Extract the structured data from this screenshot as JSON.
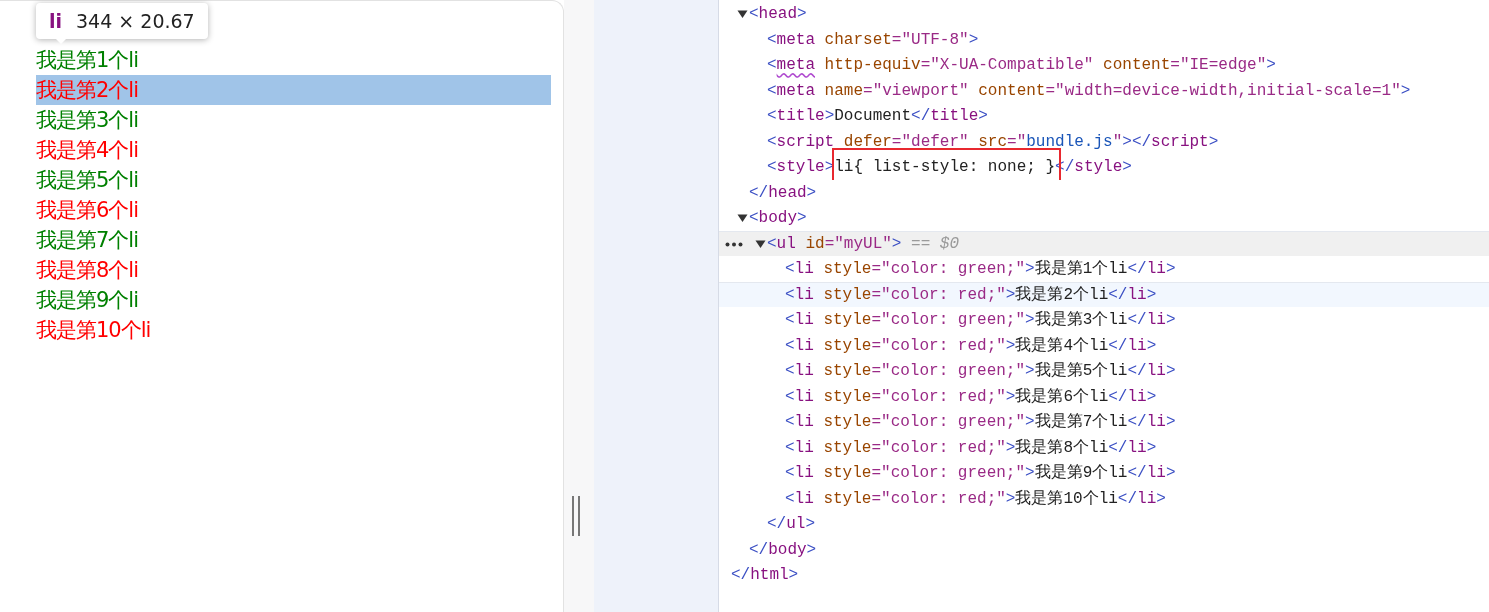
{
  "tooltip": {
    "tag": "li",
    "size": "344 × 20.67"
  },
  "list_items": [
    {
      "text": "我是第1个li",
      "color": "#008000",
      "selected": false
    },
    {
      "text": "我是第2个li",
      "color": "#ff0000",
      "selected": true
    },
    {
      "text": "我是第3个li",
      "color": "#008000",
      "selected": false
    },
    {
      "text": "我是第4个li",
      "color": "#ff0000",
      "selected": false
    },
    {
      "text": "我是第5个li",
      "color": "#008000",
      "selected": false
    },
    {
      "text": "我是第6个li",
      "color": "#ff0000",
      "selected": false
    },
    {
      "text": "我是第7个li",
      "color": "#008000",
      "selected": false
    },
    {
      "text": "我是第8个li",
      "color": "#ff0000",
      "selected": false
    },
    {
      "text": "我是第9个li",
      "color": "#008000",
      "selected": false
    },
    {
      "text": "我是第10个li",
      "color": "#ff0000",
      "selected": false
    }
  ],
  "dom": {
    "close": [
      {
        "kind": "b",
        "text": "</"
      },
      {
        "kind": "tag",
        "text": "html"
      },
      {
        "kind": "b",
        "text": ">"
      }
    ],
    "children": [
      {
        "selected": false,
        "hovered": false,
        "expanded": true,
        "open": [
          {
            "kind": "b",
            "text": "<"
          },
          {
            "kind": "tag",
            "text": "head"
          },
          {
            "kind": "b",
            "text": ">"
          }
        ],
        "close": [
          {
            "kind": "b",
            "text": "</"
          },
          {
            "kind": "tag",
            "text": "head"
          },
          {
            "kind": "b",
            "text": ">"
          }
        ],
        "children": [
          {
            "selected": false,
            "hovered": false,
            "open": [
              {
                "kind": "b",
                "text": "<"
              },
              {
                "kind": "tag",
                "text": "meta"
              },
              {
                "kind": "attr",
                "text": " charset"
              },
              {
                "kind": "val",
                "text": "=\"UTF-8\""
              },
              {
                "kind": "b",
                "text": ">"
              }
            ]
          },
          {
            "selected": false,
            "hovered": false,
            "open": [
              {
                "kind": "b",
                "text": "<"
              },
              {
                "kind": "tag",
                "text": "meta",
                "squiggle": true
              },
              {
                "kind": "attr",
                "text": " http-equiv"
              },
              {
                "kind": "val",
                "text": "=\"X-UA-Compatible\""
              },
              {
                "kind": "attr",
                "text": " content"
              },
              {
                "kind": "val",
                "text": "=\"IE=edge\""
              },
              {
                "kind": "b",
                "text": ">"
              }
            ]
          },
          {
            "selected": false,
            "hovered": false,
            "open": [
              {
                "kind": "b",
                "text": "<"
              },
              {
                "kind": "tag",
                "text": "meta"
              },
              {
                "kind": "attr",
                "text": " name"
              },
              {
                "kind": "val",
                "text": "=\"viewport\""
              },
              {
                "kind": "attr",
                "text": " content"
              },
              {
                "kind": "val",
                "text": "=\"width=device-width,initial-scale=1\""
              },
              {
                "kind": "b",
                "text": ">"
              }
            ]
          },
          {
            "selected": false,
            "hovered": false,
            "open": [
              {
                "kind": "b",
                "text": "<"
              },
              {
                "kind": "tag",
                "text": "title"
              },
              {
                "kind": "b",
                "text": ">"
              },
              {
                "kind": "text",
                "text": "Document"
              },
              {
                "kind": "b",
                "text": "</"
              },
              {
                "kind": "tag",
                "text": "title"
              },
              {
                "kind": "b",
                "text": ">"
              }
            ]
          },
          {
            "selected": false,
            "hovered": false,
            "open": [
              {
                "kind": "b",
                "text": "<"
              },
              {
                "kind": "tag",
                "text": "script"
              },
              {
                "kind": "attr",
                "text": " defer"
              },
              {
                "kind": "val",
                "text": "=\"defer\""
              },
              {
                "kind": "attr",
                "text": " src"
              },
              {
                "kind": "val",
                "text": "=\""
              },
              {
                "kind": "link",
                "text": "bundle.js"
              },
              {
                "kind": "val",
                "text": "\""
              },
              {
                "kind": "b",
                "text": ">"
              },
              {
                "kind": "b",
                "text": "</"
              },
              {
                "kind": "tag",
                "text": "script"
              },
              {
                "kind": "b",
                "text": ">"
              }
            ]
          },
          {
            "selected": false,
            "hovered": false,
            "open": [
              {
                "kind": "b",
                "text": "<"
              },
              {
                "kind": "tag",
                "text": "style"
              },
              {
                "kind": "b",
                "text": ">"
              },
              {
                "kind": "text",
                "text": "li{ list-style: none; }",
                "boxed": true
              },
              {
                "kind": "b",
                "text": "</"
              },
              {
                "kind": "tag",
                "text": "style"
              },
              {
                "kind": "b",
                "text": ">"
              }
            ]
          }
        ]
      },
      {
        "selected": false,
        "hovered": false,
        "expanded": true,
        "open": [
          {
            "kind": "b",
            "text": "<"
          },
          {
            "kind": "tag",
            "text": "body"
          },
          {
            "kind": "b",
            "text": ">"
          }
        ],
        "close": [
          {
            "kind": "b",
            "text": "</"
          },
          {
            "kind": "tag",
            "text": "body"
          },
          {
            "kind": "b",
            "text": ">"
          }
        ],
        "children": [
          {
            "selected": true,
            "hovered": false,
            "expanded": true,
            "open": [
              {
                "kind": "b",
                "text": "<"
              },
              {
                "kind": "tag",
                "text": "ul"
              },
              {
                "kind": "attr",
                "text": " id"
              },
              {
                "kind": "val",
                "text": "=\"myUL\""
              },
              {
                "kind": "b",
                "text": ">"
              },
              {
                "kind": "note",
                "text": " == $0"
              }
            ],
            "close": [
              {
                "kind": "b",
                "text": "</"
              },
              {
                "kind": "tag",
                "text": "ul"
              },
              {
                "kind": "b",
                "text": ">"
              }
            ],
            "children": [
              {
                "selected": false,
                "hovered": false,
                "open": [
                  {
                    "kind": "b",
                    "text": "<"
                  },
                  {
                    "kind": "tag",
                    "text": "li"
                  },
                  {
                    "kind": "attr",
                    "text": " style"
                  },
                  {
                    "kind": "val",
                    "text": "=\"color: green;\""
                  },
                  {
                    "kind": "b",
                    "text": ">"
                  },
                  {
                    "kind": "text",
                    "text": "我是第1个li"
                  },
                  {
                    "kind": "b",
                    "text": "</"
                  },
                  {
                    "kind": "tag",
                    "text": "li"
                  },
                  {
                    "kind": "b",
                    "text": ">"
                  }
                ]
              },
              {
                "selected": false,
                "hovered": true,
                "open": [
                  {
                    "kind": "b",
                    "text": "<"
                  },
                  {
                    "kind": "tag",
                    "text": "li"
                  },
                  {
                    "kind": "attr",
                    "text": " style"
                  },
                  {
                    "kind": "val",
                    "text": "=\"color: red;\""
                  },
                  {
                    "kind": "b",
                    "text": ">"
                  },
                  {
                    "kind": "text",
                    "text": "我是第2个li"
                  },
                  {
                    "kind": "b",
                    "text": "</"
                  },
                  {
                    "kind": "tag",
                    "text": "li"
                  },
                  {
                    "kind": "b",
                    "text": ">"
                  }
                ]
              },
              {
                "selected": false,
                "hovered": false,
                "open": [
                  {
                    "kind": "b",
                    "text": "<"
                  },
                  {
                    "kind": "tag",
                    "text": "li"
                  },
                  {
                    "kind": "attr",
                    "text": " style"
                  },
                  {
                    "kind": "val",
                    "text": "=\"color: green;\""
                  },
                  {
                    "kind": "b",
                    "text": ">"
                  },
                  {
                    "kind": "text",
                    "text": "我是第3个li"
                  },
                  {
                    "kind": "b",
                    "text": "</"
                  },
                  {
                    "kind": "tag",
                    "text": "li"
                  },
                  {
                    "kind": "b",
                    "text": ">"
                  }
                ]
              },
              {
                "selected": false,
                "hovered": false,
                "open": [
                  {
                    "kind": "b",
                    "text": "<"
                  },
                  {
                    "kind": "tag",
                    "text": "li"
                  },
                  {
                    "kind": "attr",
                    "text": " style"
                  },
                  {
                    "kind": "val",
                    "text": "=\"color: red;\""
                  },
                  {
                    "kind": "b",
                    "text": ">"
                  },
                  {
                    "kind": "text",
                    "text": "我是第4个li"
                  },
                  {
                    "kind": "b",
                    "text": "</"
                  },
                  {
                    "kind": "tag",
                    "text": "li"
                  },
                  {
                    "kind": "b",
                    "text": ">"
                  }
                ]
              },
              {
                "selected": false,
                "hovered": false,
                "open": [
                  {
                    "kind": "b",
                    "text": "<"
                  },
                  {
                    "kind": "tag",
                    "text": "li"
                  },
                  {
                    "kind": "attr",
                    "text": " style"
                  },
                  {
                    "kind": "val",
                    "text": "=\"color: green;\""
                  },
                  {
                    "kind": "b",
                    "text": ">"
                  },
                  {
                    "kind": "text",
                    "text": "我是第5个li"
                  },
                  {
                    "kind": "b",
                    "text": "</"
                  },
                  {
                    "kind": "tag",
                    "text": "li"
                  },
                  {
                    "kind": "b",
                    "text": ">"
                  }
                ]
              },
              {
                "selected": false,
                "hovered": false,
                "open": [
                  {
                    "kind": "b",
                    "text": "<"
                  },
                  {
                    "kind": "tag",
                    "text": "li"
                  },
                  {
                    "kind": "attr",
                    "text": " style"
                  },
                  {
                    "kind": "val",
                    "text": "=\"color: red;\""
                  },
                  {
                    "kind": "b",
                    "text": ">"
                  },
                  {
                    "kind": "text",
                    "text": "我是第6个li"
                  },
                  {
                    "kind": "b",
                    "text": "</"
                  },
                  {
                    "kind": "tag",
                    "text": "li"
                  },
                  {
                    "kind": "b",
                    "text": ">"
                  }
                ]
              },
              {
                "selected": false,
                "hovered": false,
                "open": [
                  {
                    "kind": "b",
                    "text": "<"
                  },
                  {
                    "kind": "tag",
                    "text": "li"
                  },
                  {
                    "kind": "attr",
                    "text": " style"
                  },
                  {
                    "kind": "val",
                    "text": "=\"color: green;\""
                  },
                  {
                    "kind": "b",
                    "text": ">"
                  },
                  {
                    "kind": "text",
                    "text": "我是第7个li"
                  },
                  {
                    "kind": "b",
                    "text": "</"
                  },
                  {
                    "kind": "tag",
                    "text": "li"
                  },
                  {
                    "kind": "b",
                    "text": ">"
                  }
                ]
              },
              {
                "selected": false,
                "hovered": false,
                "open": [
                  {
                    "kind": "b",
                    "text": "<"
                  },
                  {
                    "kind": "tag",
                    "text": "li"
                  },
                  {
                    "kind": "attr",
                    "text": " style"
                  },
                  {
                    "kind": "val",
                    "text": "=\"color: red;\""
                  },
                  {
                    "kind": "b",
                    "text": ">"
                  },
                  {
                    "kind": "text",
                    "text": "我是第8个li"
                  },
                  {
                    "kind": "b",
                    "text": "</"
                  },
                  {
                    "kind": "tag",
                    "text": "li"
                  },
                  {
                    "kind": "b",
                    "text": ">"
                  }
                ]
              },
              {
                "selected": false,
                "hovered": false,
                "open": [
                  {
                    "kind": "b",
                    "text": "<"
                  },
                  {
                    "kind": "tag",
                    "text": "li"
                  },
                  {
                    "kind": "attr",
                    "text": " style"
                  },
                  {
                    "kind": "val",
                    "text": "=\"color: green;\""
                  },
                  {
                    "kind": "b",
                    "text": ">"
                  },
                  {
                    "kind": "text",
                    "text": "我是第9个li"
                  },
                  {
                    "kind": "b",
                    "text": "</"
                  },
                  {
                    "kind": "tag",
                    "text": "li"
                  },
                  {
                    "kind": "b",
                    "text": ">"
                  }
                ]
              },
              {
                "selected": false,
                "hovered": false,
                "open": [
                  {
                    "kind": "b",
                    "text": "<"
                  },
                  {
                    "kind": "tag",
                    "text": "li"
                  },
                  {
                    "kind": "attr",
                    "text": " style"
                  },
                  {
                    "kind": "val",
                    "text": "=\"color: red;\""
                  },
                  {
                    "kind": "b",
                    "text": ">"
                  },
                  {
                    "kind": "text",
                    "text": "我是第10个li"
                  },
                  {
                    "kind": "b",
                    "text": "</"
                  },
                  {
                    "kind": "tag",
                    "text": "li"
                  },
                  {
                    "kind": "b",
                    "text": ">"
                  }
                ]
              }
            ]
          }
        ]
      }
    ]
  }
}
